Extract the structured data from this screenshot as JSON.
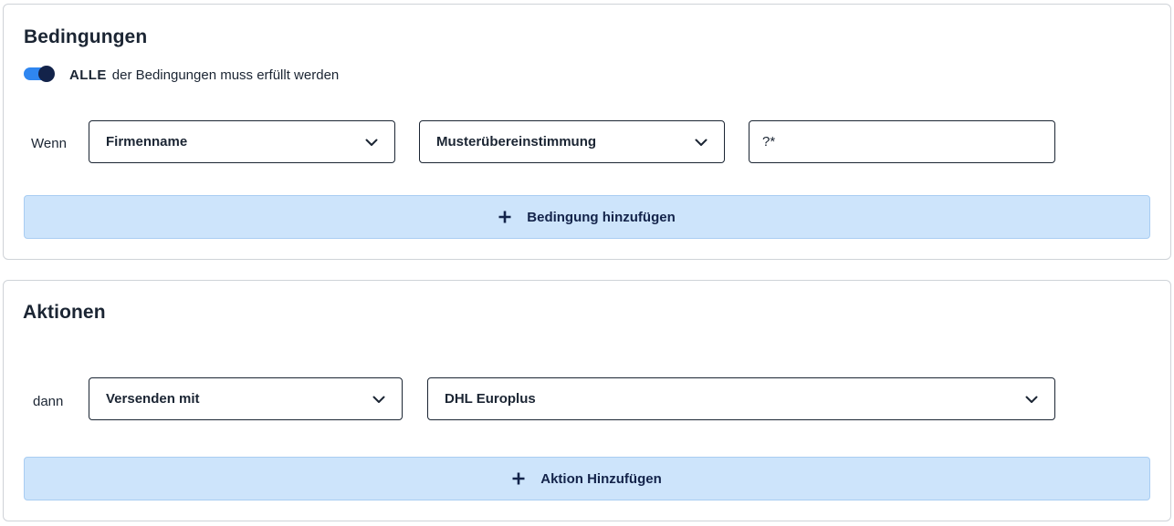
{
  "conditions": {
    "title": "Bedingungen",
    "toggle": {
      "on": true,
      "strong": "ALLE",
      "text": "der Bedingungen muss erfüllt werden"
    },
    "row_label": "Wenn",
    "field_select": "Firmenname",
    "operator_select": "Musterübereinstimmung",
    "value_input": "?*",
    "add_label": "Bedingung hinzufügen"
  },
  "actions": {
    "title": "Aktionen",
    "row_label": "dann",
    "action_select": "Versenden mit",
    "carrier_select": "DHL Europlus",
    "add_label": "Aktion Hinzufügen"
  },
  "icons": {
    "dropdown": "chevron-down-icon",
    "add": "plus-icon"
  },
  "colors": {
    "toggle_track": "#2f86f0",
    "toggle_knob": "#13234a",
    "add_bar_bg": "#cde4fb",
    "border_dark": "#1b2533"
  }
}
